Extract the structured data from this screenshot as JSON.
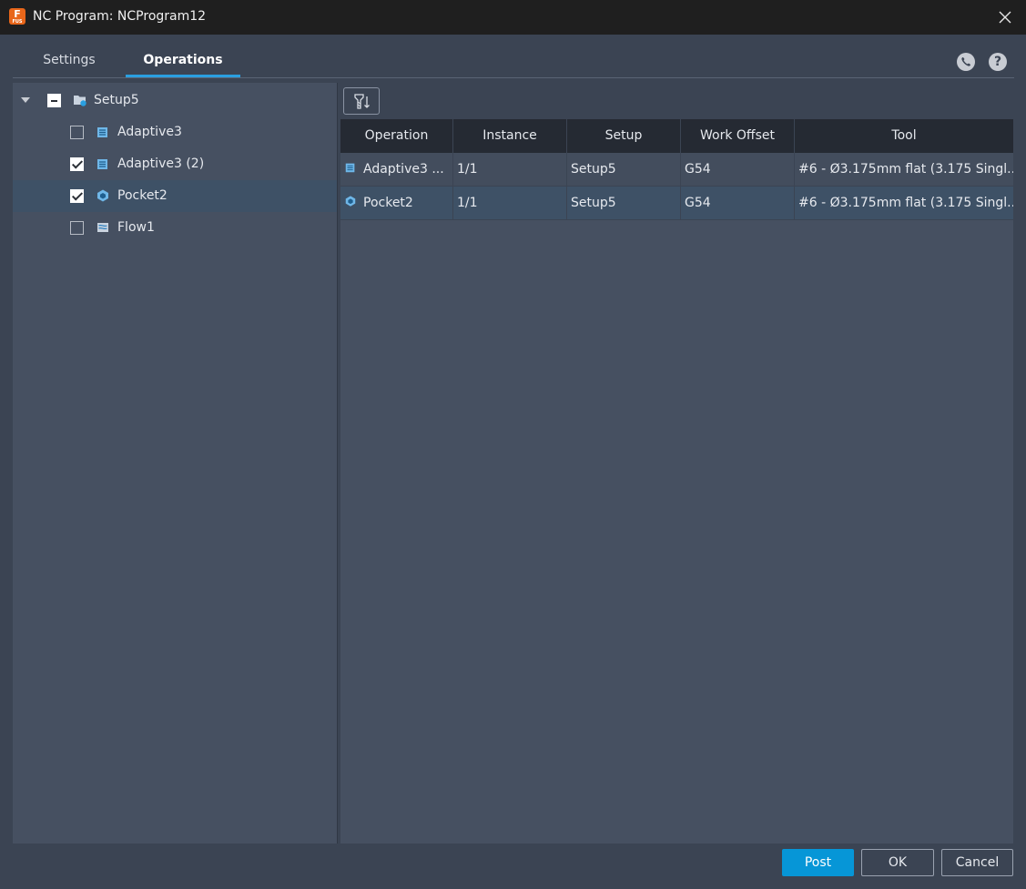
{
  "window": {
    "title": "NC Program: NCProgram12",
    "app_icon_letter": "F",
    "app_icon_sub": "FUS"
  },
  "tabs": [
    {
      "label": "Settings",
      "active": false
    },
    {
      "label": "Operations",
      "active": true
    }
  ],
  "header_icons": [
    "contact-icon",
    "help-icon"
  ],
  "tree": {
    "root": {
      "label": "Setup5",
      "state": "partial",
      "expanded": true,
      "icon": "setup-folder-icon"
    },
    "items": [
      {
        "label": "Adaptive3",
        "checked": false,
        "icon": "adaptive-op-icon",
        "selected": false
      },
      {
        "label": "Adaptive3 (2)",
        "checked": true,
        "icon": "adaptive-op-icon",
        "selected": false
      },
      {
        "label": "Pocket2",
        "checked": true,
        "icon": "pocket-op-icon",
        "selected": true
      },
      {
        "label": "Flow1",
        "checked": false,
        "icon": "flow-op-icon",
        "selected": false
      }
    ]
  },
  "grid": {
    "toolbar_icon": "tool-sort-icon",
    "columns": [
      "Operation",
      "Instance",
      "Setup",
      "Work Offset",
      "Tool"
    ],
    "rows": [
      {
        "operation": "Adaptive3 ...",
        "icon": "adaptive-op-icon",
        "instance": "1/1",
        "setup": "Setup5",
        "work_offset": "G54",
        "tool": "#6 - Ø3.175mm flat (3.175 Singl...",
        "selected": false
      },
      {
        "operation": "Pocket2",
        "icon": "pocket-op-icon",
        "instance": "1/1",
        "setup": "Setup5",
        "work_offset": "G54",
        "tool": "#6 - Ø3.175mm flat (3.175 Singl...",
        "selected": true
      }
    ]
  },
  "footer": {
    "post_label": "Post",
    "ok_label": "OK",
    "cancel_label": "Cancel"
  },
  "colors": {
    "accent": "#0696d7",
    "tab_underline": "#2a9fe0",
    "background": "#3b4453",
    "selection": "#3e5166"
  }
}
